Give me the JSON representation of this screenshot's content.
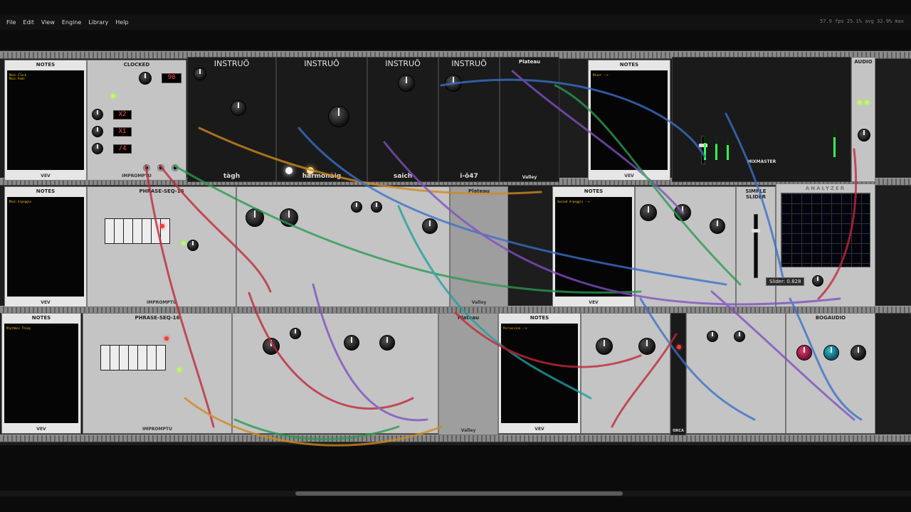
{
  "menubar": {
    "items": [
      "File",
      "Edit",
      "View",
      "Engine",
      "Library",
      "Help"
    ],
    "status": "57.9 fps  25.1% avg  32.9% max"
  },
  "tooltip": "Slider: 0.828",
  "notes_modules": [
    {
      "title": "NOTES",
      "text": "Main Clock\nMain Pads",
      "brand": "VEV"
    },
    {
      "title": "NOTES",
      "text": "Main Arpeggio",
      "brand": "VEV"
    },
    {
      "title": "NOTES",
      "text": "Rhythmic Thing",
      "brand": "VEV"
    },
    {
      "title": "NOTES",
      "text": "Mixer -->",
      "brand": "VEV"
    },
    {
      "title": "NOTES",
      "text": "Second Arpeggio -->",
      "brand": "VEV"
    },
    {
      "title": "NOTES",
      "text": "Percussion -->",
      "brand": "VEV"
    }
  ],
  "modules": {
    "clocked": {
      "title": "CLOCKED",
      "brand": "IMPROMPTU",
      "bpm": "90",
      "ratios": [
        "X2",
        "X1",
        "/4"
      ]
    },
    "phrase1": {
      "title": "PHRASE-SEQ-16",
      "brand": "IMPROMPTU"
    },
    "phrase2": {
      "title": "PHRASE-SEQ-16",
      "brand": "IMPROMPTU"
    },
    "instruo": [
      "INSTRUŌ",
      "INSTRUŌ",
      "INSTRUŌ",
      "INSTRUŌ"
    ],
    "instruo_names": [
      "tàgh",
      "harmonàig",
      "saich",
      "i-ō47"
    ],
    "plateau1": {
      "title": "Plateau",
      "brand": "Valley"
    },
    "plateau2": {
      "title": "Plateau",
      "brand": "Valley"
    },
    "plateau3": {
      "title": "Plateau",
      "brand": "Valley"
    },
    "mixmaster": {
      "title": "MIXMASTER"
    },
    "audio": {
      "title": "AUDIO"
    },
    "simple_slider": {
      "title": "SIMPLE SLIDER"
    },
    "analyzer": {
      "title": "ANALYZER"
    },
    "bogaudio": {
      "title": "BOGAUDIO"
    },
    "brand_nano": "ORCA"
  },
  "colors": {
    "cable_red": "#c0283a",
    "cable_green": "#2a9a50",
    "cable_blue": "#3a70c8",
    "cable_orange": "#d08a20",
    "cable_purple": "#8050c0",
    "cable_teal": "#20a0a0"
  }
}
